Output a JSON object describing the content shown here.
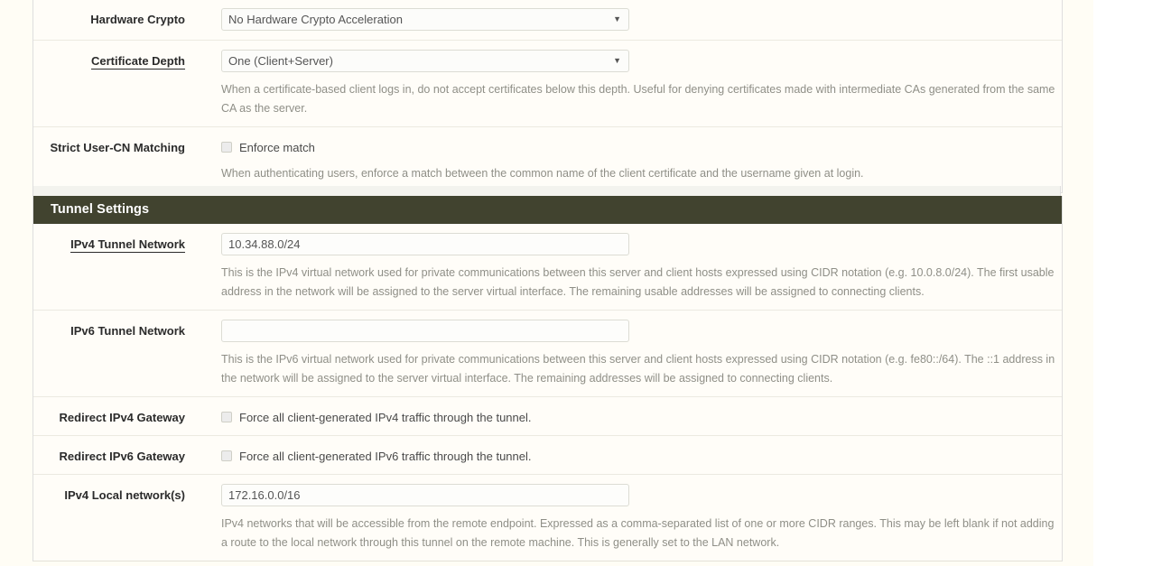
{
  "panel": {
    "rows": [
      {
        "id": "hardware-crypto",
        "label": "Hardware Crypto",
        "underlined": false,
        "control": "select",
        "value": "No Hardware Crypto Acceleration",
        "help": ""
      },
      {
        "id": "certificate-depth",
        "label": "Certificate Depth",
        "underlined": true,
        "control": "select",
        "value": "One (Client+Server)",
        "help": "When a certificate-based client logs in, do not accept certificates below this depth. Useful for denying certificates made with intermediate CAs generated from the same CA as the server."
      },
      {
        "id": "strict-user-cn-matching",
        "label": "Strict User-CN Matching",
        "underlined": false,
        "control": "checkbox",
        "checkbox_label": "Enforce match",
        "checked": false,
        "help": "When authenticating users, enforce a match between the common name of the client certificate and the username given at login."
      }
    ]
  },
  "section": {
    "title": "Tunnel Settings",
    "rows": [
      {
        "id": "ipv4-tunnel-network",
        "label": "IPv4 Tunnel Network",
        "underlined": true,
        "control": "text",
        "value": "10.34.88.0/24",
        "placeholder": "",
        "help": "This is the IPv4 virtual network used for private communications between this server and client hosts expressed using CIDR notation (e.g. 10.0.8.0/24). The first usable address in the network will be assigned to the server virtual interface. The remaining usable addresses will be assigned to connecting clients."
      },
      {
        "id": "ipv6-tunnel-network",
        "label": "IPv6 Tunnel Network",
        "underlined": false,
        "control": "text",
        "value": "",
        "placeholder": "",
        "help": "This is the IPv6 virtual network used for private communications between this server and client hosts expressed using CIDR notation (e.g. fe80::/64). The ::1 address in the network will be assigned to the server virtual interface. The remaining addresses will be assigned to connecting clients."
      },
      {
        "id": "redirect-ipv4-gateway",
        "label": "Redirect IPv4 Gateway",
        "underlined": false,
        "control": "checkbox",
        "checkbox_label": "Force all client-generated IPv4 traffic through the tunnel.",
        "checked": false,
        "help": ""
      },
      {
        "id": "redirect-ipv6-gateway",
        "label": "Redirect IPv6 Gateway",
        "underlined": false,
        "control": "checkbox",
        "checkbox_label": "Force all client-generated IPv6 traffic through the tunnel.",
        "checked": false,
        "help": ""
      },
      {
        "id": "ipv4-local-networks",
        "label": "IPv4 Local network(s)",
        "underlined": false,
        "control": "text",
        "value": "172.16.0.0/16",
        "placeholder": "",
        "help": "IPv4 networks that will be accessible from the remote endpoint. Expressed as a comma-separated list of one or more CIDR ranges. This may be left blank if not adding a route to the local network through this tunnel on the remote machine. This is generally set to the LAN network."
      }
    ]
  },
  "icons": {
    "caret": "▼"
  },
  "colors": {
    "section_header_bg": "#41432f",
    "panel_bg": "#fffdf8",
    "page_bg": "#fffdf5",
    "help_text": "#8f8f87",
    "label_text": "#2b2b2b"
  }
}
